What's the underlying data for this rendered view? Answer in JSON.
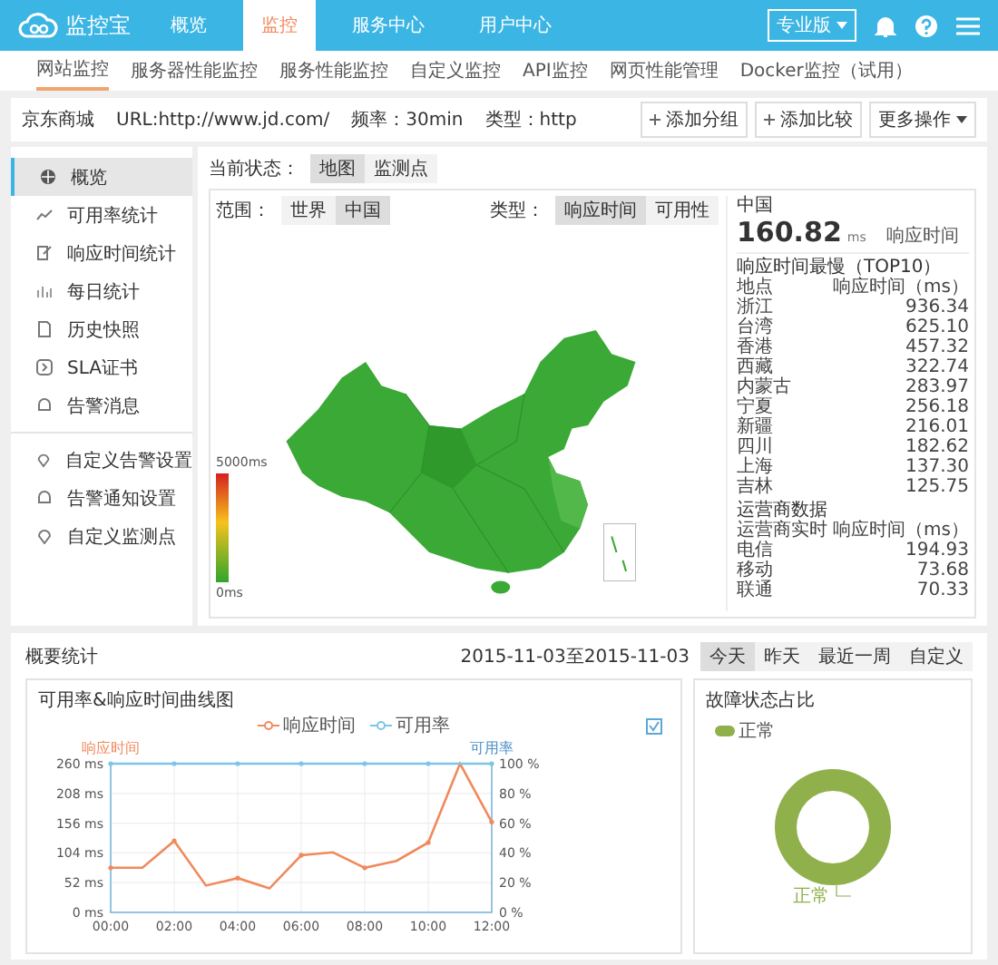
{
  "app": {
    "logo": "监控宝",
    "edition": "专业版",
    "nav": [
      {
        "label": "概览",
        "selected": false
      },
      {
        "label": "监控",
        "selected": true
      },
      {
        "label": "服务中心",
        "selected": false
      },
      {
        "label": "用户中心",
        "selected": false
      }
    ]
  },
  "subnav": [
    {
      "label": "网站监控",
      "selected": true
    },
    {
      "label": "服务器性能监控",
      "selected": false
    },
    {
      "label": "服务性能监控",
      "selected": false
    },
    {
      "label": "自定义监控",
      "selected": false
    },
    {
      "label": "API监控",
      "selected": false
    },
    {
      "label": "网页性能管理",
      "selected": false
    },
    {
      "label": "Docker监控（试用）",
      "selected": false
    }
  ],
  "monitor": {
    "name": "京东商城",
    "url": "URL:http://www.jd.com/",
    "frequency": "频率：30min",
    "type": "类型：http"
  },
  "actions": [
    {
      "label": "添加分组",
      "kind": "add"
    },
    {
      "label": "添加比较",
      "kind": "add"
    },
    {
      "label": "更多操作",
      "kind": "menu"
    }
  ],
  "sidebar": {
    "groups": [
      [
        {
          "label": "概览",
          "selected": true
        },
        {
          "label": "可用率统计",
          "selected": false
        },
        {
          "label": "响应时间统计",
          "selected": false
        },
        {
          "label": "每日统计",
          "selected": false
        },
        {
          "label": "历史快照",
          "selected": false
        },
        {
          "label": "SLA证书",
          "selected": false
        },
        {
          "label": "告警消息",
          "selected": false
        }
      ],
      [
        {
          "label": "自定义告警设置",
          "selected": false
        },
        {
          "label": "告警通知设置",
          "selected": false
        },
        {
          "label": "自定义监测点",
          "selected": false
        }
      ]
    ]
  },
  "status": {
    "label": "当前状态：",
    "options": [
      {
        "label": "地图",
        "selected": true
      },
      {
        "label": "监测点",
        "selected": false
      }
    ]
  },
  "map": {
    "scope_label": "范围：",
    "scopes": [
      {
        "label": "世界",
        "selected": false
      },
      {
        "label": "中国",
        "selected": true
      }
    ],
    "type_label": "类型：",
    "types": [
      {
        "label": "响应时间",
        "selected": true
      },
      {
        "label": "可用性",
        "selected": false
      }
    ],
    "legend_max": "5000ms",
    "legend_min": "0ms"
  },
  "summary": {
    "region": "中国",
    "value": "160.82",
    "unit": "ms",
    "metric": "响应时间",
    "top_title": "响应时间最慢（TOP10）",
    "top_columns": [
      "地点",
      "响应时间（ms）"
    ],
    "top_rows": [
      {
        "place": "浙江",
        "value": "936.34"
      },
      {
        "place": "台湾",
        "value": "625.10"
      },
      {
        "place": "香港",
        "value": "457.32"
      },
      {
        "place": "西藏",
        "value": "322.74"
      },
      {
        "place": "内蒙古",
        "value": "283.97"
      },
      {
        "place": "宁夏",
        "value": "256.18"
      },
      {
        "place": "新疆",
        "value": "216.01"
      },
      {
        "place": "四川",
        "value": "182.62"
      },
      {
        "place": "上海",
        "value": "137.30"
      },
      {
        "place": "吉林",
        "value": "125.75"
      }
    ],
    "isp_title": "运营商数据",
    "isp_columns": [
      "运营商实时",
      "响应时间（ms）"
    ],
    "isp_rows": [
      {
        "place": "电信",
        "value": "194.93"
      },
      {
        "place": "移动",
        "value": "73.68"
      },
      {
        "place": "联通",
        "value": "70.33"
      }
    ]
  },
  "overview": {
    "title": "概要统计",
    "date_range": "2015-11-03至2015-11-03",
    "ranges": [
      {
        "label": "今天",
        "selected": true
      },
      {
        "label": "昨天",
        "selected": false
      },
      {
        "label": "最近一周",
        "selected": false
      },
      {
        "label": "自定义",
        "selected": false
      }
    ],
    "trend": {
      "title": "可用率&响应时间曲线图",
      "chart_data": {
        "type": "line",
        "ylabel": "响应时间",
        "y2label": "可用率",
        "x": [
          0,
          1,
          2,
          3,
          4,
          5,
          6,
          7,
          8,
          9,
          10,
          11,
          12
        ],
        "xlim": [
          0,
          12
        ],
        "grid": true,
        "xticks": [
          {
            "value": 0,
            "label": "00:00"
          },
          {
            "value": 2,
            "label": "02:00"
          },
          {
            "value": 4,
            "label": "04:00"
          },
          {
            "value": 6,
            "label": "06:00"
          },
          {
            "value": 8,
            "label": "08:00"
          },
          {
            "value": 10,
            "label": "10:00"
          },
          {
            "value": 12,
            "label": "12:00"
          }
        ],
        "ylim": [
          0,
          260
        ],
        "yticks": [
          {
            "value": 0,
            "label": "0 ms"
          },
          {
            "value": 52,
            "label": "52 ms"
          },
          {
            "value": 104,
            "label": "104 ms"
          },
          {
            "value": 156,
            "label": "156 ms"
          },
          {
            "value": 208,
            "label": "208 ms"
          },
          {
            "value": 260,
            "label": "260 ms"
          }
        ],
        "y2lim": [
          0,
          100
        ],
        "y2ticks": [
          {
            "value": 0,
            "label": "0 %"
          },
          {
            "value": 20,
            "label": "20 %"
          },
          {
            "value": 40,
            "label": "40 %"
          },
          {
            "value": 60,
            "label": "60 %"
          },
          {
            "value": 80,
            "label": "80 %"
          },
          {
            "value": 100,
            "label": "100 %"
          }
        ],
        "series": [
          {
            "name": "响应时间",
            "color": "#f08a5d",
            "values": [
              78,
              78,
              125,
              47,
              60,
              42,
              100,
              105,
              78,
              90,
              122,
              260,
              158
            ]
          },
          {
            "name": "可用率",
            "color": "#7cc5e6",
            "axis": "y2",
            "values": [
              100,
              100,
              100,
              100,
              100,
              100,
              100,
              100,
              100,
              100,
              100,
              100,
              100
            ]
          }
        ]
      }
    },
    "fault": {
      "title": "故障状态占比",
      "chart_data": {
        "type": "pie",
        "categories": [
          "正常"
        ],
        "values": [
          100
        ],
        "colors": [
          "#8fb04a"
        ]
      }
    }
  }
}
